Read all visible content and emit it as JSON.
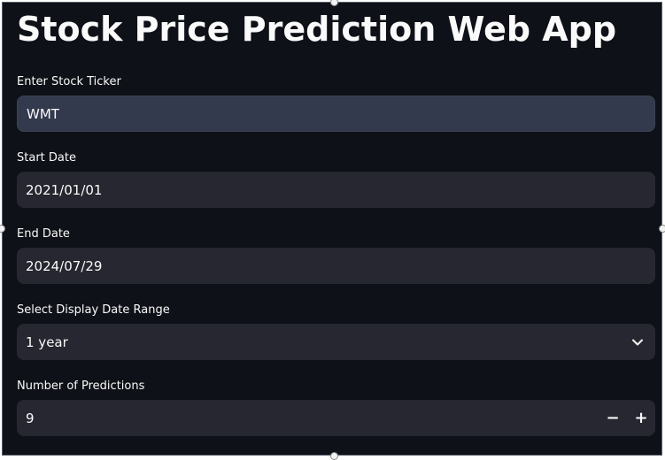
{
  "app": {
    "title": "Stock Price Prediction Web App"
  },
  "form": {
    "ticker": {
      "label": "Enter Stock Ticker",
      "value": "WMT"
    },
    "start_date": {
      "label": "Start Date",
      "value": "2021/01/01"
    },
    "end_date": {
      "label": "End Date",
      "value": "2024/07/29"
    },
    "display_range": {
      "label": "Select Display Date Range",
      "selected": "1 year"
    },
    "num_predictions": {
      "label": "Number of Predictions",
      "value": "9",
      "decrement": "−",
      "increment": "+"
    }
  },
  "icons": {
    "chevron": "chevron-down-icon"
  },
  "colors": {
    "background": "#0e1117",
    "input_bg": "#262730",
    "input_focused_bg": "#343a4d",
    "text": "#fafafa"
  }
}
